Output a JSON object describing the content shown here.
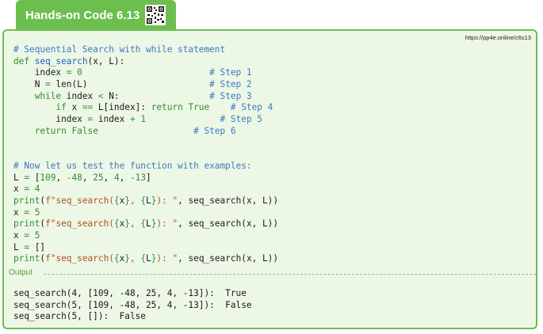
{
  "header": {
    "title": "Hands-on Code 6.13",
    "url": "https://pp4e.online/c6s13"
  },
  "code_lines": [
    [
      [
        "c",
        "# Sequential Search with while statement"
      ]
    ],
    [
      [
        "k",
        "def "
      ],
      [
        "fn",
        "seq_search"
      ],
      [
        "",
        "(x, L):"
      ]
    ],
    [
      [
        "",
        "    index "
      ],
      [
        "k",
        "="
      ],
      [
        "",
        " "
      ],
      [
        "n",
        "0"
      ],
      [
        "",
        "                        "
      ],
      [
        "c",
        "# Step 1"
      ]
    ],
    [
      [
        "",
        "    N "
      ],
      [
        "k",
        "="
      ],
      [
        "",
        " len(L)"
      ],
      [
        "",
        "                       "
      ],
      [
        "c",
        "# Step 2"
      ]
    ],
    [
      [
        "",
        "    "
      ],
      [
        "k",
        "while"
      ],
      [
        "",
        " index "
      ],
      [
        "k",
        "<"
      ],
      [
        "",
        " N:"
      ],
      [
        "",
        "                 "
      ],
      [
        "c",
        "# Step 3"
      ]
    ],
    [
      [
        "",
        "        "
      ],
      [
        "k",
        "if"
      ],
      [
        "",
        " x "
      ],
      [
        "k",
        "=="
      ],
      [
        "",
        " L[index]: "
      ],
      [
        "k",
        "return"
      ],
      [
        "",
        " "
      ],
      [
        "k",
        "True"
      ],
      [
        "",
        "    "
      ],
      [
        "c",
        "# Step 4"
      ]
    ],
    [
      [
        "",
        "        index "
      ],
      [
        "k",
        "="
      ],
      [
        "",
        " index "
      ],
      [
        "k",
        "+"
      ],
      [
        "",
        " "
      ],
      [
        "n",
        "1"
      ],
      [
        "",
        "              "
      ],
      [
        "c",
        "# Step 5"
      ]
    ],
    [
      [
        "",
        "    "
      ],
      [
        "k",
        "return"
      ],
      [
        "",
        " "
      ],
      [
        "k",
        "False"
      ],
      [
        "",
        "                  "
      ],
      [
        "c",
        "# Step 6"
      ]
    ],
    [
      [
        "",
        ""
      ]
    ],
    [
      [
        "",
        ""
      ]
    ],
    [
      [
        "c",
        "# Now let us test the function with examples:"
      ]
    ],
    [
      [
        "",
        "L "
      ],
      [
        "k",
        "="
      ],
      [
        "",
        " ["
      ],
      [
        "n",
        "109"
      ],
      [
        "",
        ", "
      ],
      [
        "k",
        "-"
      ],
      [
        "n",
        "48"
      ],
      [
        "",
        ", "
      ],
      [
        "n",
        "25"
      ],
      [
        "",
        ", "
      ],
      [
        "n",
        "4"
      ],
      [
        "",
        ", "
      ],
      [
        "k",
        "-"
      ],
      [
        "n",
        "13"
      ],
      [
        "",
        "]"
      ]
    ],
    [
      [
        "",
        "x "
      ],
      [
        "k",
        "="
      ],
      [
        "",
        " "
      ],
      [
        "n",
        "4"
      ]
    ],
    [
      [
        "k",
        "print"
      ],
      [
        "",
        "("
      ],
      [
        "s",
        "f\"seq_search("
      ],
      [
        "br",
        "{"
      ],
      [
        "",
        "x"
      ],
      [
        "br",
        "}"
      ],
      [
        "s",
        ", "
      ],
      [
        "br",
        "{"
      ],
      [
        "",
        "L"
      ],
      [
        "br",
        "}"
      ],
      [
        "s",
        "): \""
      ],
      [
        "",
        ", seq_search(x, L))"
      ]
    ],
    [
      [
        "",
        "x "
      ],
      [
        "k",
        "="
      ],
      [
        "",
        " "
      ],
      [
        "n",
        "5"
      ]
    ],
    [
      [
        "k",
        "print"
      ],
      [
        "",
        "("
      ],
      [
        "s",
        "f\"seq_search("
      ],
      [
        "br",
        "{"
      ],
      [
        "",
        "x"
      ],
      [
        "br",
        "}"
      ],
      [
        "s",
        ", "
      ],
      [
        "br",
        "{"
      ],
      [
        "",
        "L"
      ],
      [
        "br",
        "}"
      ],
      [
        "s",
        "): \""
      ],
      [
        "",
        ", seq_search(x, L))"
      ]
    ],
    [
      [
        "",
        "x "
      ],
      [
        "k",
        "="
      ],
      [
        "",
        " "
      ],
      [
        "n",
        "5"
      ]
    ],
    [
      [
        "",
        "L "
      ],
      [
        "k",
        "="
      ],
      [
        "",
        " []"
      ]
    ],
    [
      [
        "k",
        "print"
      ],
      [
        "",
        "("
      ],
      [
        "s",
        "f\"seq_search("
      ],
      [
        "br",
        "{"
      ],
      [
        "",
        "x"
      ],
      [
        "br",
        "}"
      ],
      [
        "s",
        ", "
      ],
      [
        "br",
        "{"
      ],
      [
        "",
        "L"
      ],
      [
        "br",
        "}"
      ],
      [
        "s",
        "): \""
      ],
      [
        "",
        ", seq_search(x, L))"
      ]
    ]
  ],
  "output": {
    "label": "Output",
    "lines": [
      "seq_search(4, [109, -48, 25, 4, -13]):  True",
      "seq_search(5, [109, -48, 25, 4, -13]):  False",
      "seq_search(5, []):  False"
    ]
  },
  "colors": {
    "accent": "#6cbf4e",
    "panel_bg": "#edf7e6",
    "keyword": "#2f8f2f",
    "comment": "#3b7ac0",
    "string": "#b0521c"
  },
  "icons": {
    "qr": "qr-code-icon"
  }
}
